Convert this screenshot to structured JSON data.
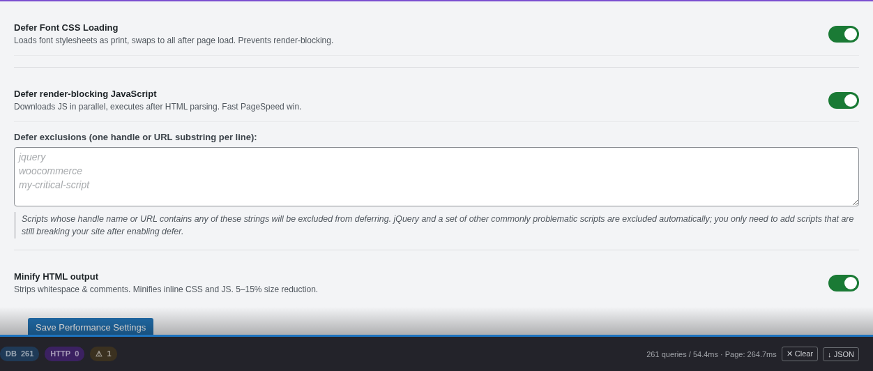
{
  "settings": [
    {
      "kind": "toggle",
      "title": "Defer Font CSS Loading",
      "description": "Loads font stylesheets as print, swaps to all after page load. Prevents render-blocking.",
      "on": true
    },
    {
      "kind": "toggle",
      "title": "Defer render-blocking JavaScript",
      "description": "Downloads JS in parallel, executes after HTML parsing. Fast PageSpeed win.",
      "on": true
    },
    {
      "kind": "textarea",
      "label": "Defer exclusions (one handle or URL substring per line):",
      "placeholder": "jquery\nwoocommerce\nmy-critical-script",
      "note": "Scripts whose handle name or URL contains any of these strings will be excluded from deferring. jQuery and a set of other commonly problematic scripts are excluded automatically; you only need to add scripts that are still breaking your site after enabling defer."
    },
    {
      "kind": "toggle",
      "title": "Minify HTML output",
      "description": "Strips whitespace & comments. Minifies inline CSS and JS. 5–15% size reduction.",
      "on": true
    }
  ],
  "save_button": "Save Performance Settings",
  "debug_bar": {
    "badges": [
      {
        "label": "DB",
        "count": "261",
        "color": "#1f3a57"
      },
      {
        "label": "HTTP",
        "count": "0",
        "color": "#3b2161"
      },
      {
        "label": "⚠",
        "count": "1",
        "color": "#3b3120"
      }
    ],
    "summary": "261 queries / 54.4ms · Page: 264.7ms",
    "buttons": [
      {
        "icon": "✕",
        "label": "Clear"
      },
      {
        "icon": "↓",
        "label": "JSON"
      }
    ]
  }
}
